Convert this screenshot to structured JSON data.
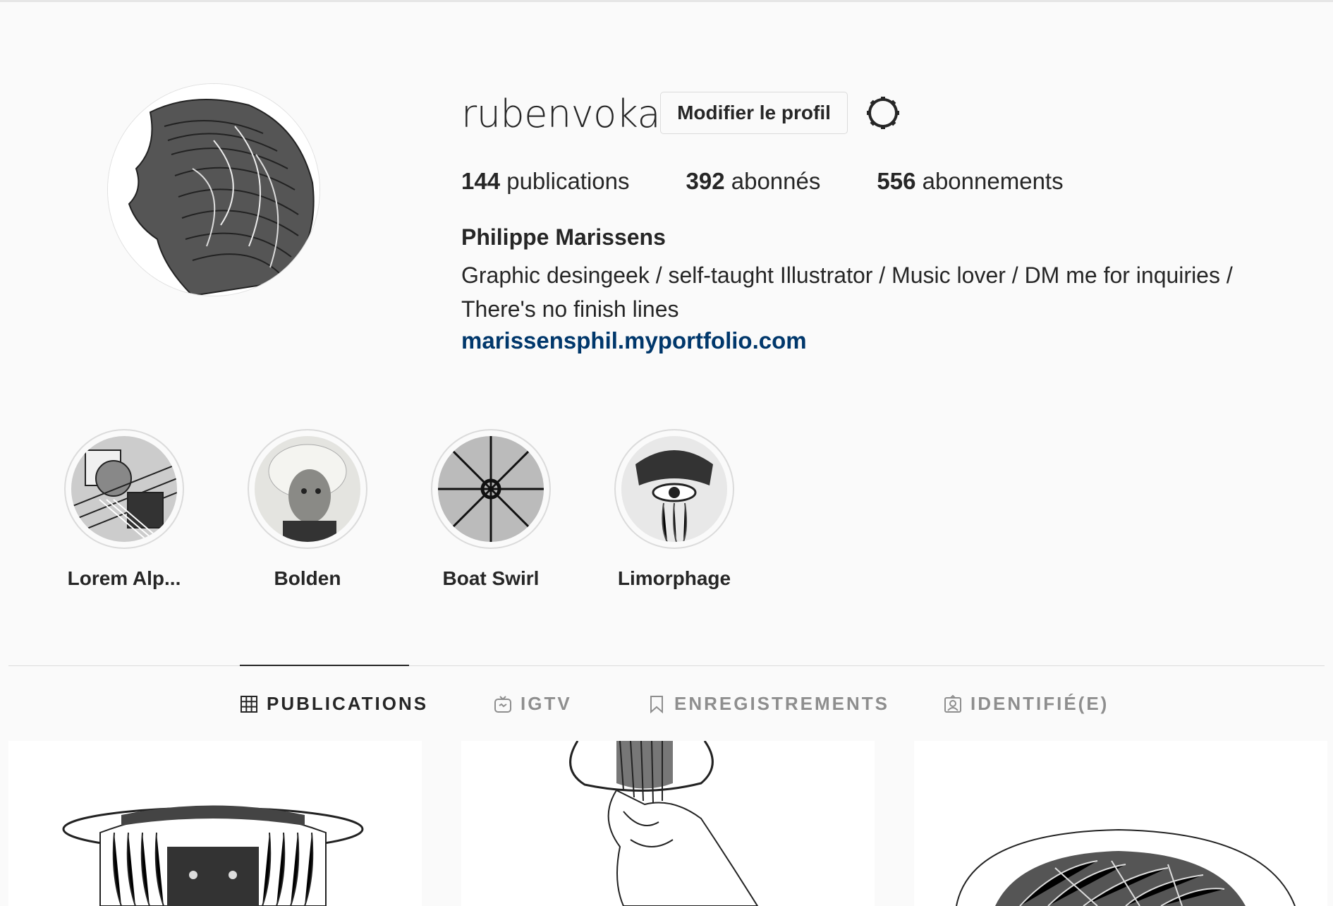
{
  "profile": {
    "username": "rubenvoka",
    "edit_label": "Modifier le profil",
    "stats": {
      "posts_count": "144",
      "posts_label": " publications",
      "followers_count": "392",
      "followers_label": " abonnés",
      "following_count": "556",
      "following_label": " abonnements"
    },
    "full_name": "Philippe Marissens",
    "bio": "Graphic desingeek / self-taught Illustrator / Music lover / DM me for inquiries / There's no finish lines",
    "website": "marissensphil.myportfolio.com"
  },
  "highlights": [
    {
      "label": "Lorem Alp..."
    },
    {
      "label": "Bolden"
    },
    {
      "label": "Boat Swirl"
    },
    {
      "label": "Limorphage"
    }
  ],
  "tabs": [
    {
      "label": "PUBLICATIONS",
      "icon": "grid-icon",
      "active": true
    },
    {
      "label": "IGTV",
      "icon": "igtv-icon",
      "active": false
    },
    {
      "label": "ENREGISTREMENTS",
      "icon": "bookmark-icon",
      "active": false
    },
    {
      "label": "IDENTIFIÉ(E)",
      "icon": "tagged-icon",
      "active": false
    }
  ],
  "colors": {
    "background": "#fafafa",
    "text": "#262626",
    "muted": "#8e8e8e",
    "link": "#00376b",
    "border": "#dbdbdb"
  }
}
